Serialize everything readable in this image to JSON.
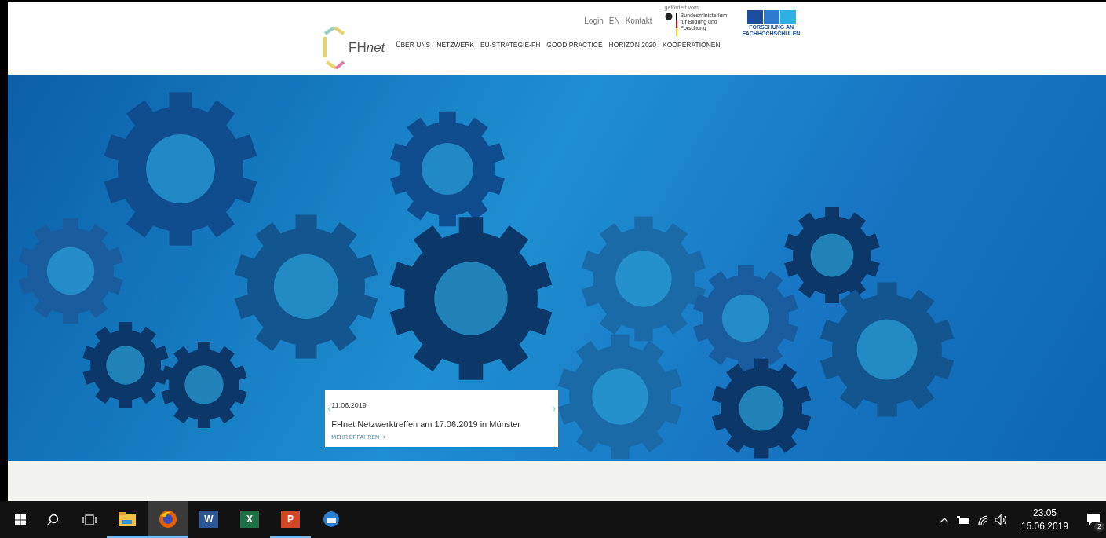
{
  "header": {
    "logo_text": {
      "plain": "FH",
      "italic": "net"
    },
    "top_links": [
      "Login",
      "EN",
      "Kontakt"
    ],
    "sponsor": {
      "caption": "gefördert vom",
      "ministry": "Bundesministerium für Bildung und Forschung",
      "program": "FORSCHUNG AN FACHHOCHSCHULEN"
    },
    "nav": [
      "ÜBER UNS",
      "NETZWERK",
      "EU-STRATEGIE-FH",
      "GOOD PRACTICE",
      "HORIZON 2020",
      "KOOPERATIONEN"
    ]
  },
  "slide": {
    "date": "11.06.2019",
    "title": "FHnet Netzwerktreffen am 17.06.2019 in Münster",
    "link": "MEHR ERFAHREN",
    "arrow": "›",
    "prev": "‹",
    "next": "›"
  },
  "taskbar": {
    "apps": [
      {
        "kind": "explorer",
        "running": true,
        "selected": false
      },
      {
        "kind": "firefox",
        "running": true,
        "selected": true
      },
      {
        "kind": "word",
        "label": "W",
        "running": false,
        "selected": false
      },
      {
        "kind": "excel",
        "label": "X",
        "running": false,
        "selected": false
      },
      {
        "kind": "powerpoint",
        "label": "P",
        "running": true,
        "selected": false
      },
      {
        "kind": "thunderbird",
        "running": false,
        "selected": false
      }
    ],
    "time": "23:05",
    "date": "15.06.2019",
    "notifications": "2"
  }
}
